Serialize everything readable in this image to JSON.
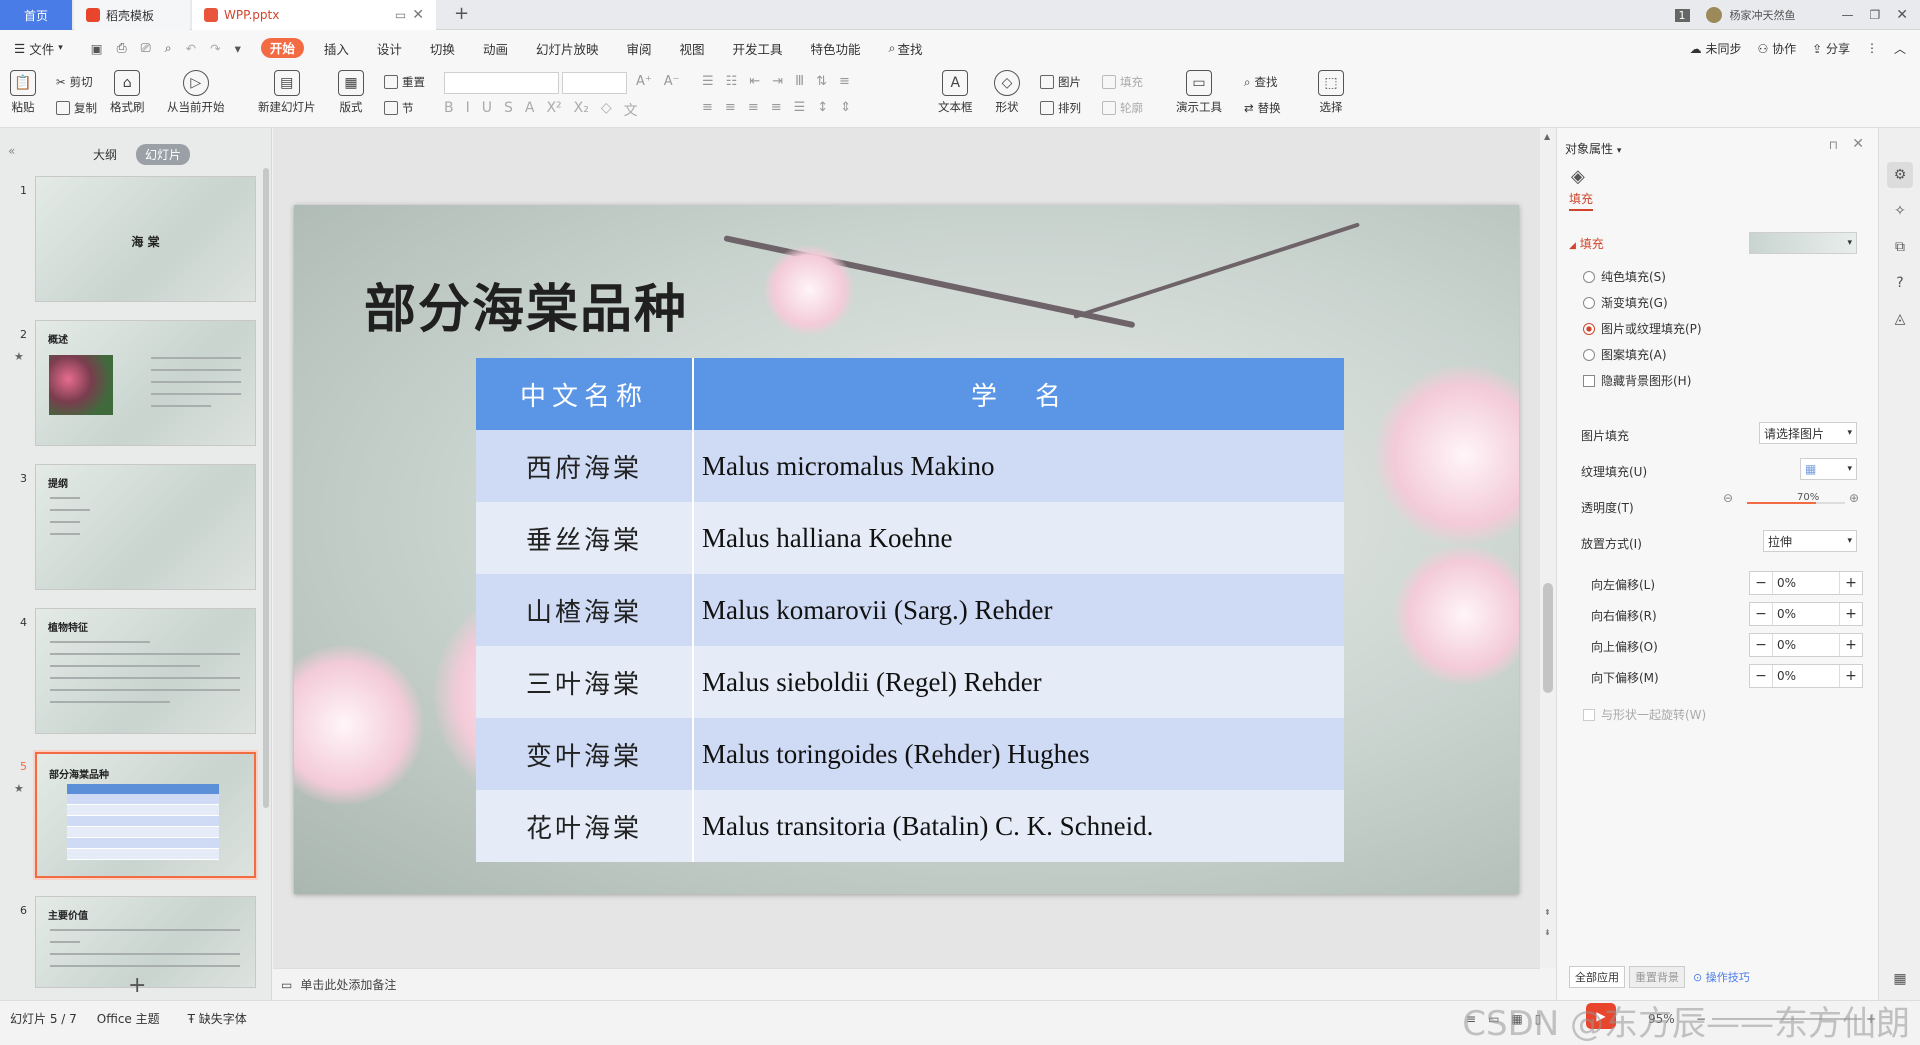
{
  "titlebar": {
    "tab_home": "首页",
    "tab_templates": "稻壳模板",
    "tab_file": "WPP.pptx",
    "badge": "1",
    "user": "杨家冲天然鱼"
  },
  "menu": {
    "file": "文件",
    "items": [
      "开始",
      "插入",
      "设计",
      "切换",
      "动画",
      "幻灯片放映",
      "审阅",
      "视图",
      "开发工具",
      "特色功能",
      "查找"
    ],
    "sync": "未同步",
    "collab": "协作",
    "share": "分享"
  },
  "ribbon": {
    "paste": "粘贴",
    "cut": "剪切",
    "copy": "复制",
    "format_painter": "格式刷",
    "from_start": "从当前开始",
    "new_slide": "新建幻灯片",
    "layout": "版式",
    "reset": "重置",
    "section": "节",
    "textbox": "文本框",
    "shape": "形状",
    "picture": "图片",
    "fill": "填充",
    "arrange": "排列",
    "outline": "轮廓",
    "present_tools": "演示工具",
    "find": "查找",
    "replace": "替换",
    "select": "选择"
  },
  "left_panel": {
    "tab_outline": "大纲",
    "tab_slides": "幻灯片",
    "thumbs": [
      {
        "num": "1",
        "title": "海 棠"
      },
      {
        "num": "2",
        "title": "概述"
      },
      {
        "num": "3",
        "title": "提纲"
      },
      {
        "num": "4",
        "title": "植物特征"
      },
      {
        "num": "5",
        "title": "部分海棠品种"
      },
      {
        "num": "6",
        "title": "主要价值"
      }
    ]
  },
  "slide": {
    "title": "部分海棠品种",
    "header_cn": "中文名称",
    "header_sci": "学　名",
    "rows": [
      {
        "cn": "西府海棠",
        "sci": "Malus micromalus Makino"
      },
      {
        "cn": "垂丝海棠",
        "sci": "Malus halliana Koehne"
      },
      {
        "cn": "山楂海棠",
        "sci": "Malus komarovii (Sarg.) Rehder"
      },
      {
        "cn": "三叶海棠",
        "sci": "Malus sieboldii (Regel) Rehder"
      },
      {
        "cn": "变叶海棠",
        "sci": "Malus toringoides (Rehder) Hughes"
      },
      {
        "cn": "花叶海棠",
        "sci": "Malus transitoria (Batalin) C. K. Schneid."
      }
    ]
  },
  "notes": {
    "placeholder": "单击此处添加备注"
  },
  "props": {
    "title": "对象属性",
    "fill_tab": "填充",
    "section": "填充",
    "options": [
      "纯色填充(S)",
      "渐变填充(G)",
      "图片或纹理填充(P)",
      "图案填充(A)"
    ],
    "hide_bg": "隐藏背景图形(H)",
    "pic_fill_label": "图片填充",
    "pic_fill_value": "请选择图片",
    "texture_label": "纹理填充(U)",
    "transparency_label": "透明度(T)",
    "transparency_value": "70%",
    "placement_label": "放置方式(I)",
    "placement_value": "拉伸",
    "offsets": [
      {
        "label": "向左偏移(L)",
        "value": "0%"
      },
      {
        "label": "向右偏移(R)",
        "value": "0%"
      },
      {
        "label": "向上偏移(O)",
        "value": "0%"
      },
      {
        "label": "向下偏移(M)",
        "value": "0%"
      }
    ],
    "rotate_with_shape": "与形状一起旋转(W)",
    "apply_all": "全部应用",
    "reset_bg": "重置背景",
    "tips": "操作技巧"
  },
  "status": {
    "slide_info": "幻灯片 5 / 7",
    "theme": "Office 主题",
    "missing_font": "缺失字体",
    "zoom": "95%"
  },
  "watermark": "CSDN @东方辰——东方仙朗"
}
